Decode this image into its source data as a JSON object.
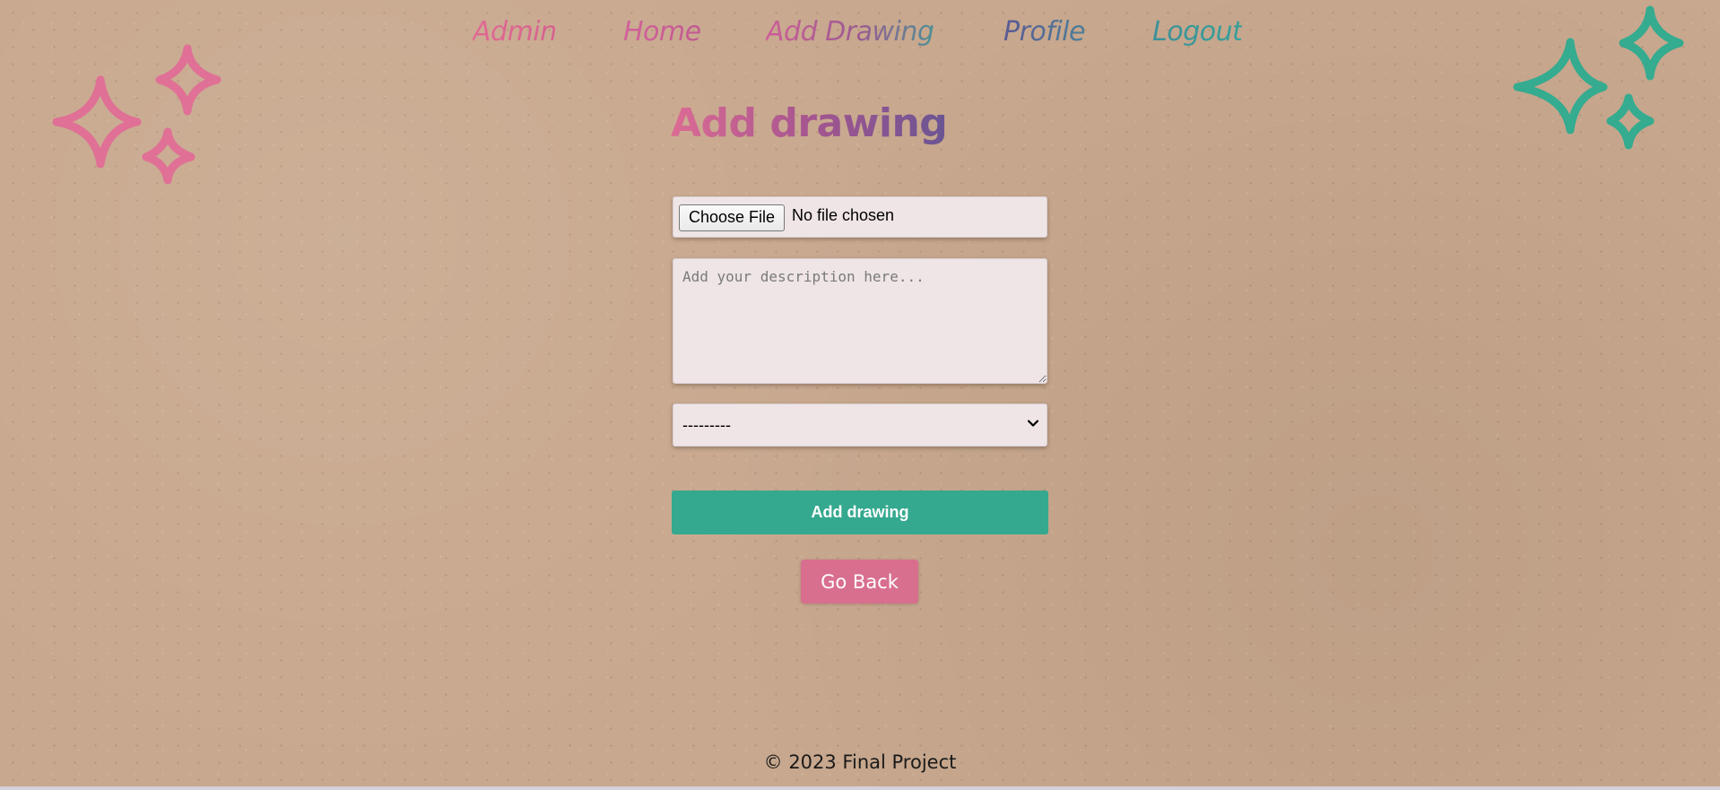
{
  "nav": {
    "items": [
      {
        "label": "Admin",
        "color": "#e06a92"
      },
      {
        "label": "Home",
        "color": "#d3619a"
      },
      {
        "label": "Add Drawing",
        "color": "#9c5a92"
      },
      {
        "label": "Profile",
        "color": "#5a5a94"
      },
      {
        "label": "Logout",
        "color": "#35a19a"
      }
    ]
  },
  "page": {
    "title": "Add drawing"
  },
  "form": {
    "file": {
      "button_label": "Choose File",
      "status": "No file chosen"
    },
    "description": {
      "value": "",
      "placeholder": "Add your description here..."
    },
    "category": {
      "selected": "---------",
      "options": [
        "---------"
      ]
    },
    "submit_label": "Add drawing"
  },
  "go_back_label": "Go Back",
  "footer": {
    "text": "© 2023 Final Project"
  },
  "decorations": {
    "left_sparkles": {
      "icon": "sparkles-icon",
      "color": "#e07095"
    },
    "right_sparkles": {
      "icon": "sparkles-icon",
      "color": "#35ab8f"
    }
  },
  "colors": {
    "background": "#c8a88e",
    "field_background": "#efe5e6",
    "primary_button": "#35a98f",
    "secondary_button": "#d86f8f"
  }
}
